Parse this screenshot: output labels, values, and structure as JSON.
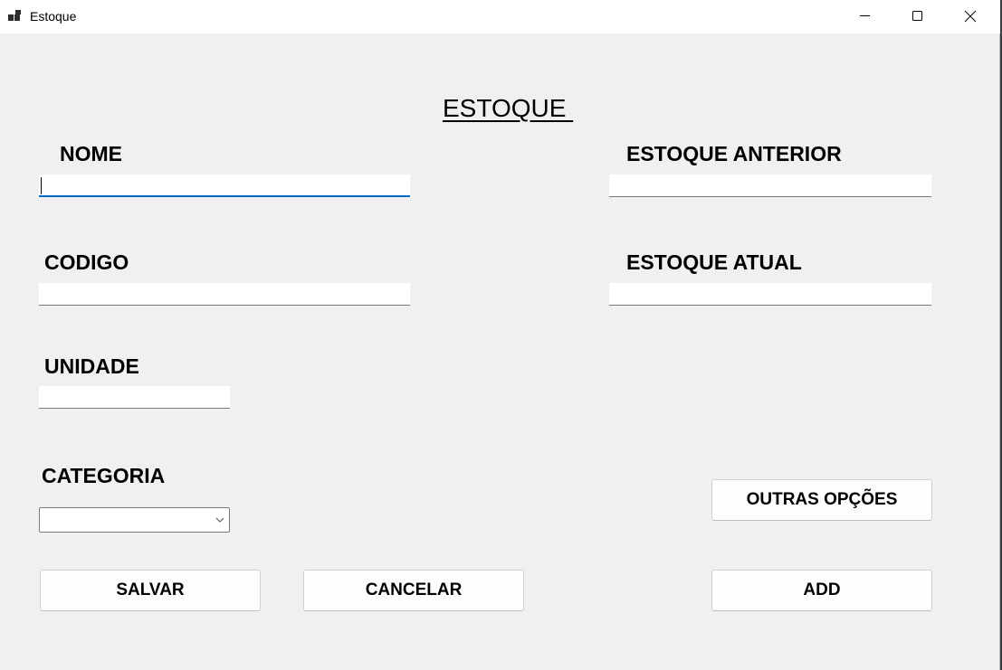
{
  "window": {
    "title": "Estoque",
    "icon": "app-window-icon",
    "controls": [
      "minimize-icon",
      "maximize-icon",
      "close-icon"
    ]
  },
  "form": {
    "heading": "ESTOQUE ",
    "nome_label": "NOME",
    "nome_value": "",
    "codigo_label": "CODIGO",
    "codigo_value": "",
    "unidade_label": "UNIDADE",
    "unidade_value": "",
    "categoria_label": "CATEGORIA",
    "categoria_value": "",
    "estoque_anterior_label": "ESTOQUE ANTERIOR",
    "estoque_anterior_value": "",
    "estoque_atual_label": "ESTOQUE ATUAL",
    "estoque_atual_value": ""
  },
  "buttons": {
    "outras_opcoes": "OUTRAS OPÇÕES",
    "salvar": "SALVAR",
    "cancelar": "CANCELAR",
    "add": "ADD"
  },
  "colors": {
    "background": "#f0f0f0",
    "titlebar": "#ffffff",
    "focus_accent": "#0067c0"
  }
}
